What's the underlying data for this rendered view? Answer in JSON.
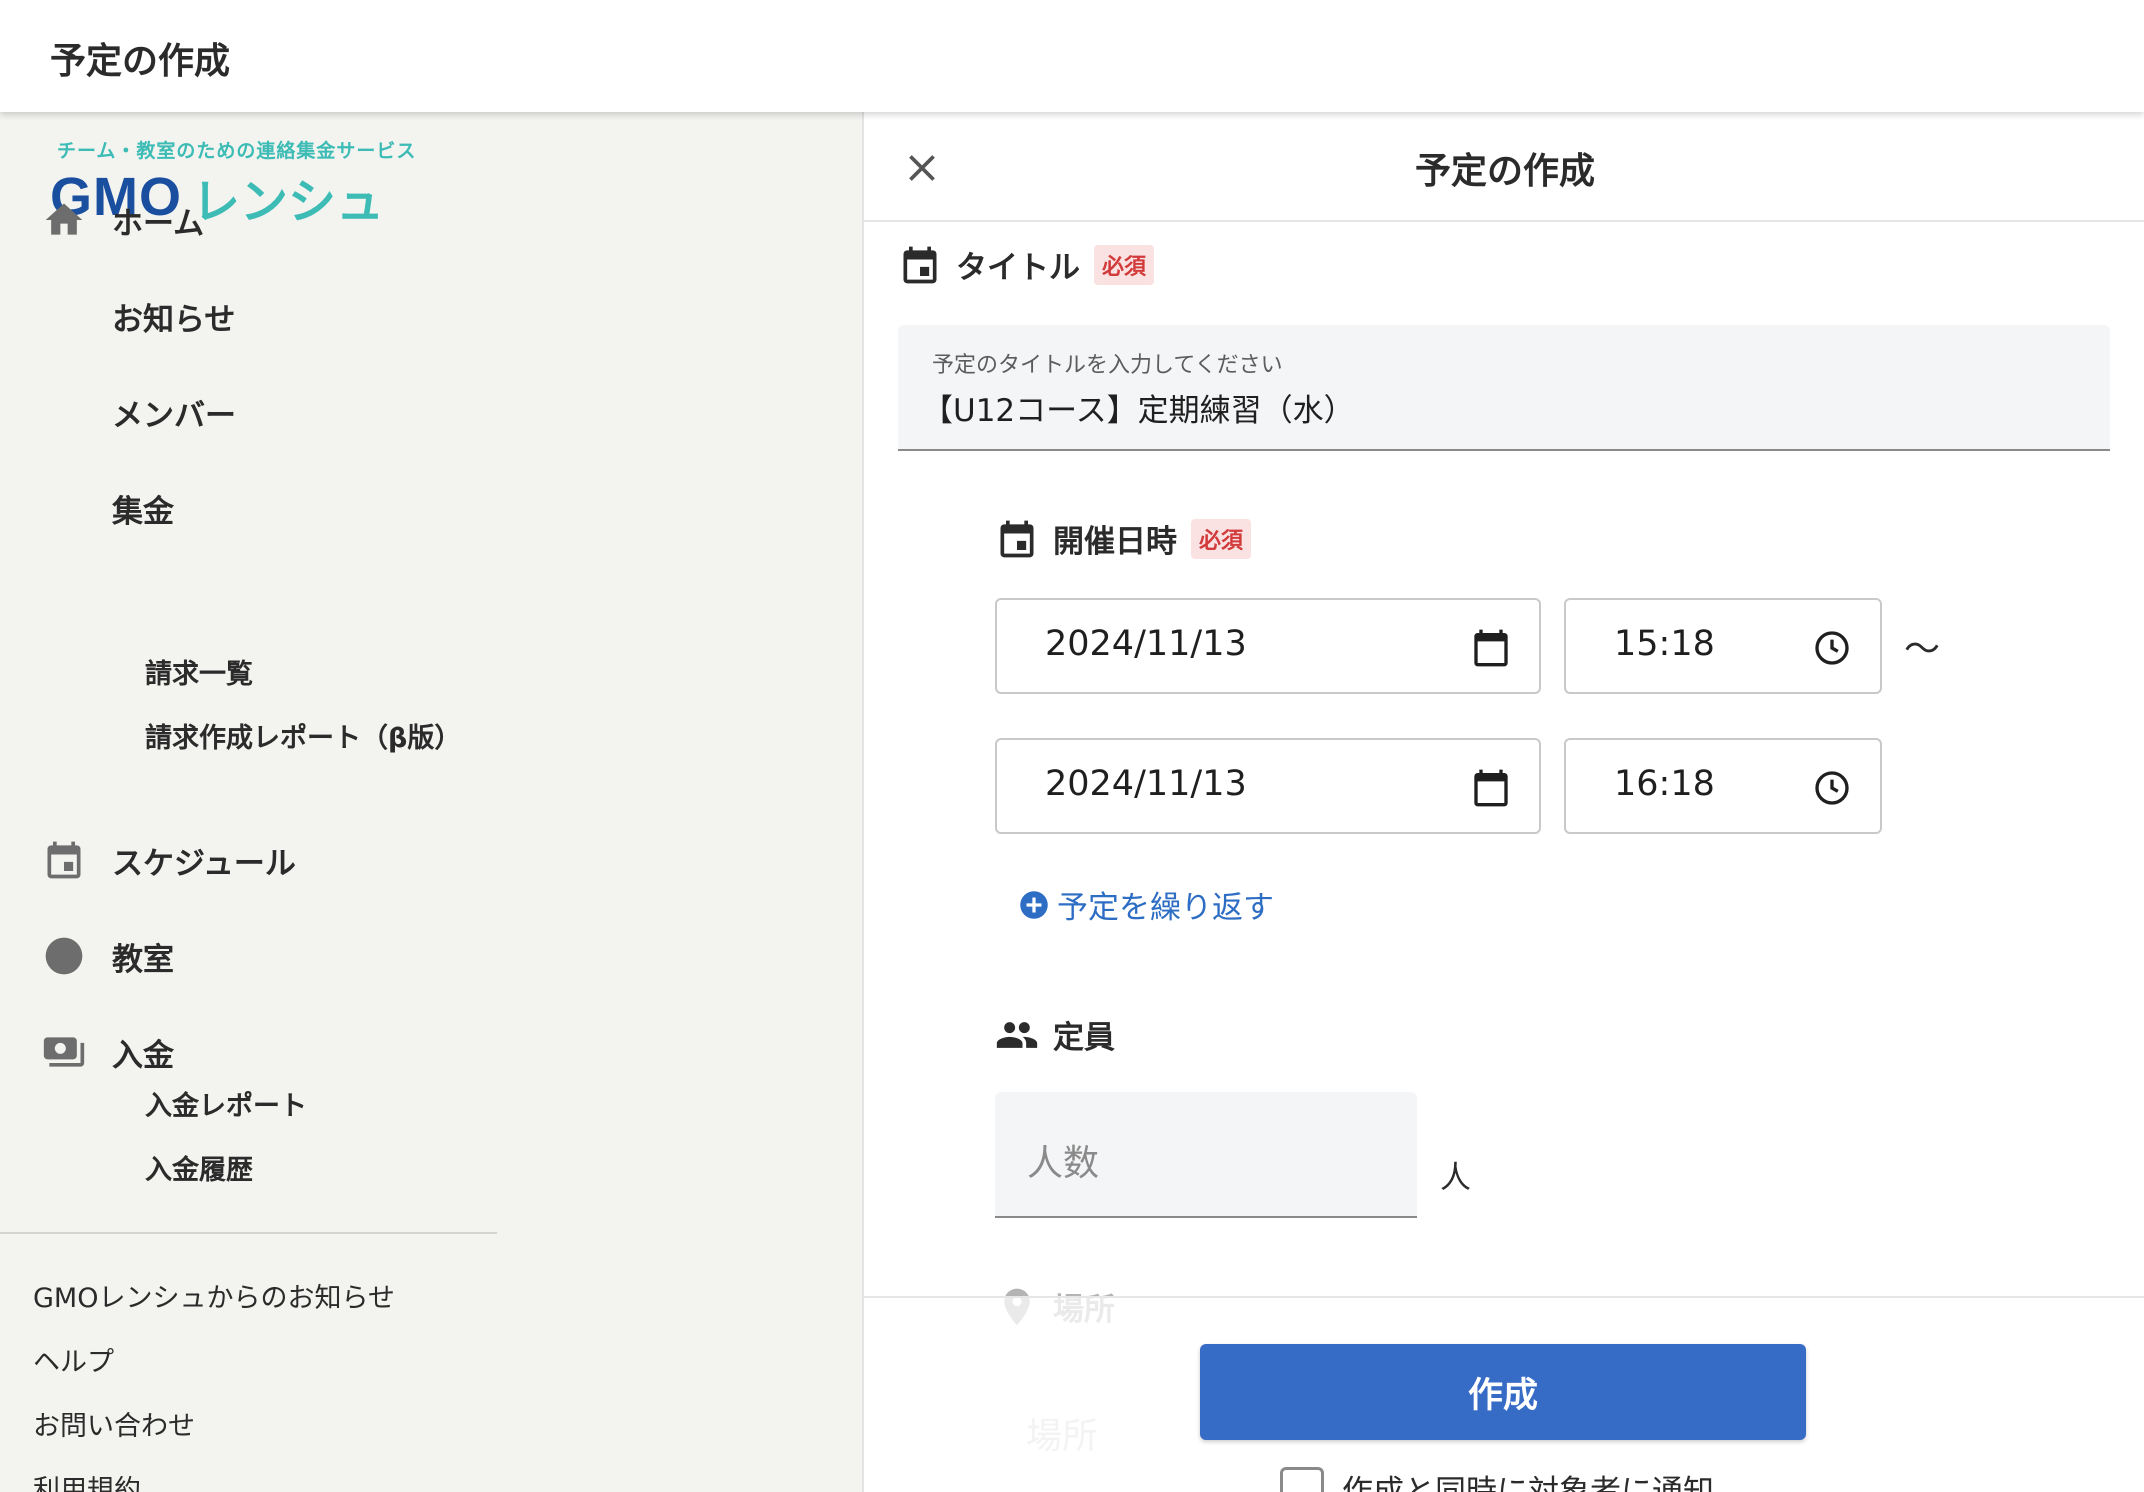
{
  "header": {
    "title": "予定の作成"
  },
  "logo": {
    "tagline": "チーム・教室のための連絡集金サービス",
    "brand_latin": "GMO",
    "brand_kana": "レンシュ"
  },
  "sidebar": {
    "items": [
      {
        "label": "ホーム",
        "icon": "home-icon"
      },
      {
        "label": "お知らせ"
      },
      {
        "label": "メンバー"
      },
      {
        "label": "集金"
      },
      {
        "label": "スケジュール",
        "icon": "calendar-icon"
      },
      {
        "label": "教室",
        "icon": "circle-icon"
      },
      {
        "label": "入金",
        "icon": "payments-icon"
      }
    ],
    "sub_billing": [
      "請求一覧",
      "請求作成レポート（β版）"
    ],
    "sub_deposit": [
      "入金レポート",
      "入金履歴"
    ],
    "footer_links": [
      "GMOレンシュからのお知らせ",
      "ヘルプ",
      "お問い合わせ",
      "利用規約"
    ]
  },
  "panel": {
    "title": "予定の作成",
    "title_section": {
      "label": "タイトル",
      "required": "必須",
      "field_label": "予定のタイトルを入力してください",
      "value": "【U12コース】定期練習（水）"
    },
    "datetime_section": {
      "label": "開催日時",
      "required": "必須",
      "start_date": "2024/11/13",
      "start_time": "15:18",
      "separator": "〜",
      "end_date": "2024/11/13",
      "end_time": "16:18",
      "repeat_label": "予定を繰り返す"
    },
    "capacity_section": {
      "label": "定員",
      "placeholder": "人数",
      "unit": "人"
    },
    "place_section": {
      "label": "場所",
      "placeholder": "場所"
    },
    "submit_label": "作成",
    "notify_label": "作成と同時に対象者に通知"
  },
  "colors": {
    "accent": "#366cc6",
    "link": "#2d6dc4",
    "brand_teal": "#3dbcb5",
    "brand_navy": "#1a4e9f",
    "required_text": "#d23b3b",
    "required_bg": "#fbe2e2"
  }
}
